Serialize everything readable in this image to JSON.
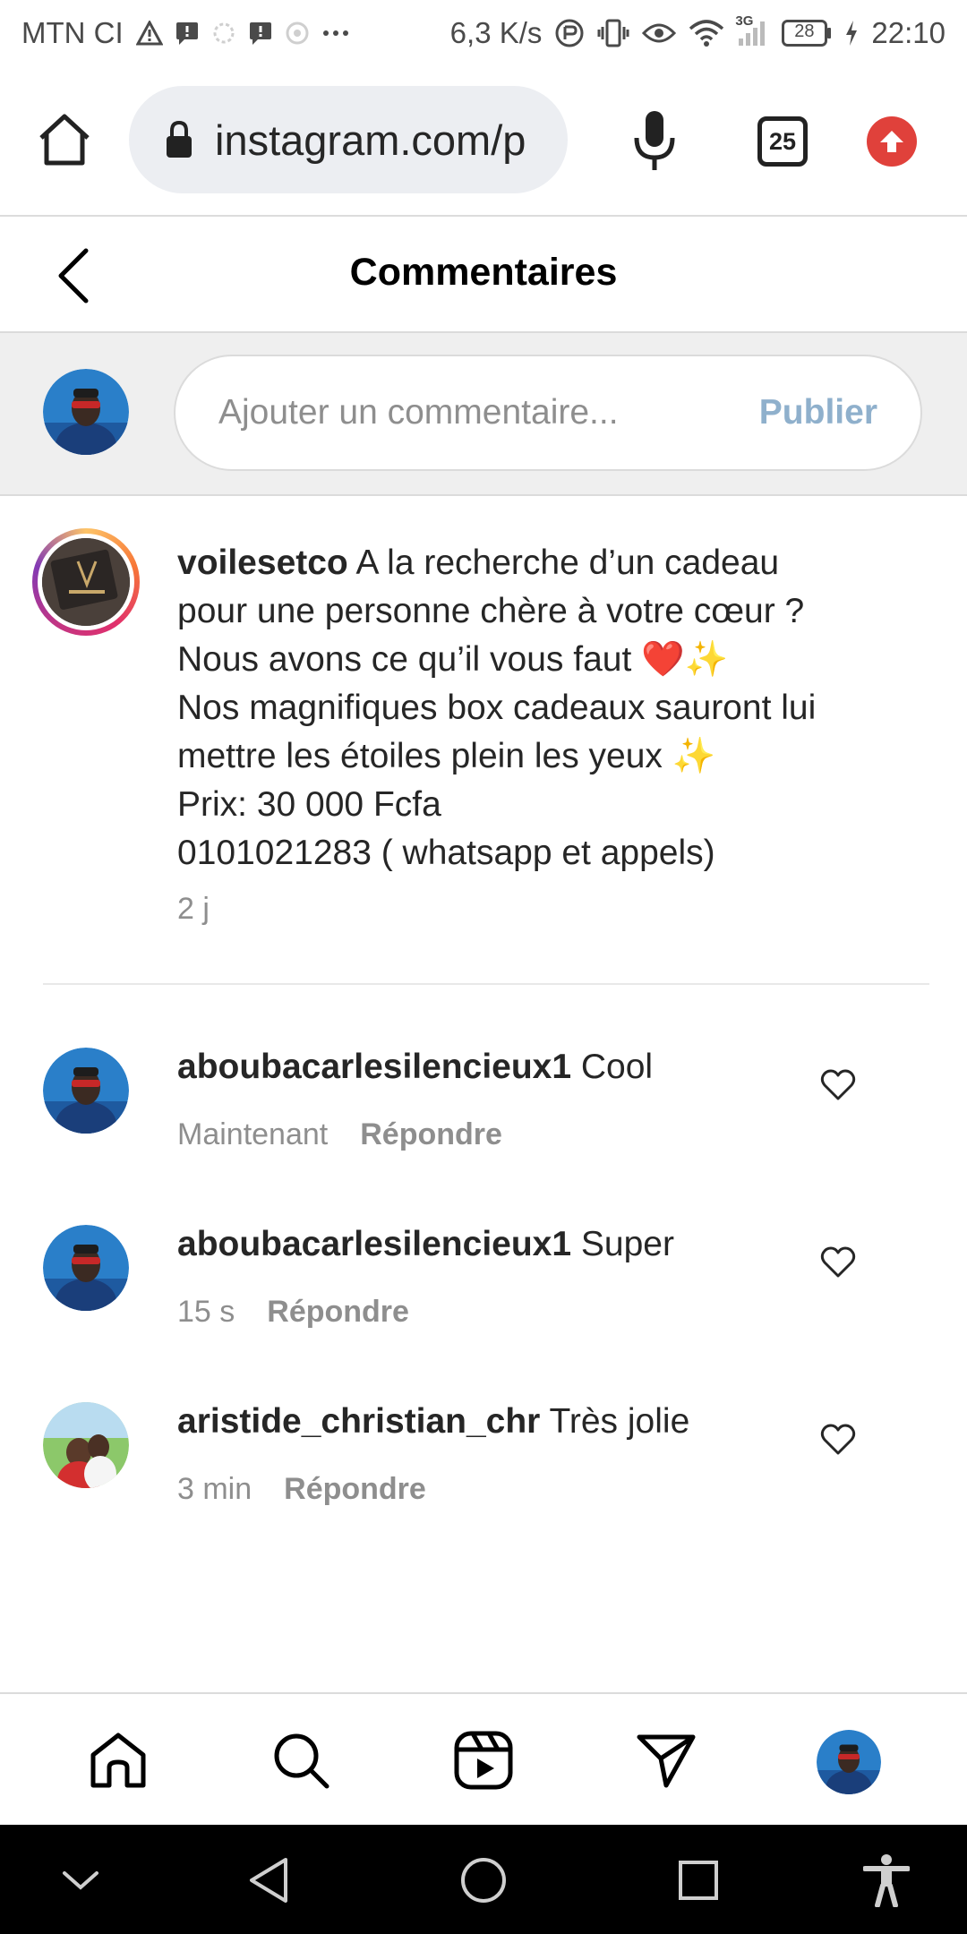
{
  "status_bar": {
    "carrier": "MTN CI",
    "speed": "6,3 K/s",
    "network": "3G",
    "battery": "28",
    "time": "22:10"
  },
  "browser": {
    "url": "instagram.com/p",
    "tab_count": "25"
  },
  "header": {
    "title": "Commentaires"
  },
  "add_comment": {
    "placeholder": "Ajouter un commentaire...",
    "publish_label": "Publier"
  },
  "caption": {
    "username": "voilesetco",
    "lines": [
      "A la recherche d’un cadeau",
      "pour une personne chère à votre cœur ?",
      "Nous avons ce qu’il vous faut ❤️✨",
      "Nos magnifiques box cadeaux sauront lui",
      "mettre les étoiles plein les yeux ✨",
      "Prix: 30 000 Fcfa",
      "0101021283 ( whatsapp et appels)"
    ],
    "time": "2 j"
  },
  "comments": [
    {
      "username": "aboubacarlesilencieux1",
      "text": "Cool",
      "time": "Maintenant",
      "reply_label": "Répondre"
    },
    {
      "username": "aboubacarlesilencieux1",
      "text": "Super",
      "time": "15 s",
      "reply_label": "Répondre"
    },
    {
      "username": "aristide_christian_chr",
      "text": "Très jolie",
      "time": "3 min",
      "reply_label": "Répondre"
    }
  ],
  "colors": {
    "publish": "#8fb0cc",
    "update_badge": "#e0413b",
    "meta_text": "#8e8e8e"
  }
}
